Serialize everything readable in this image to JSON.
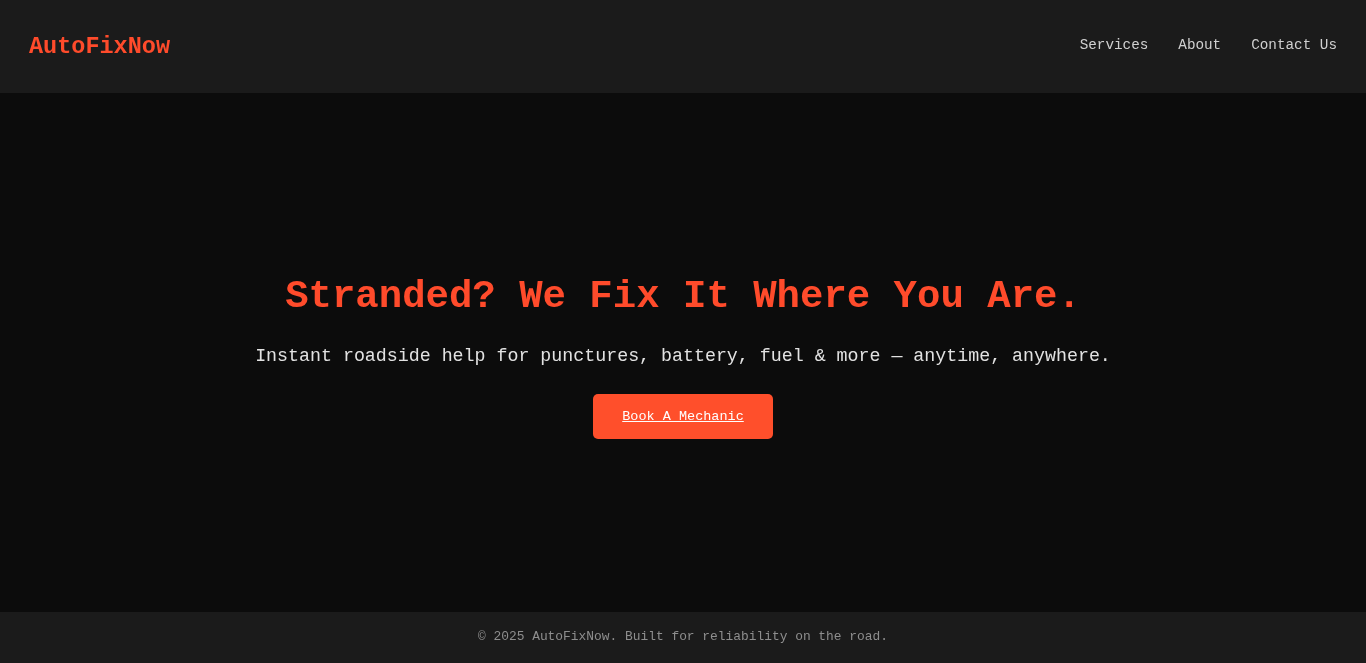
{
  "header": {
    "logo": "AutoFixNow",
    "nav": [
      {
        "label": "Services"
      },
      {
        "label": "About"
      },
      {
        "label": "Contact Us"
      }
    ]
  },
  "hero": {
    "title": "Stranded? We Fix It Where You Are.",
    "subtitle": "Instant roadside help for punctures, battery, fuel & more — anytime, anywhere.",
    "button": "Book A Mechanic"
  },
  "footer": {
    "text": "© 2025 AutoFixNow. Built for reliability on the road."
  }
}
